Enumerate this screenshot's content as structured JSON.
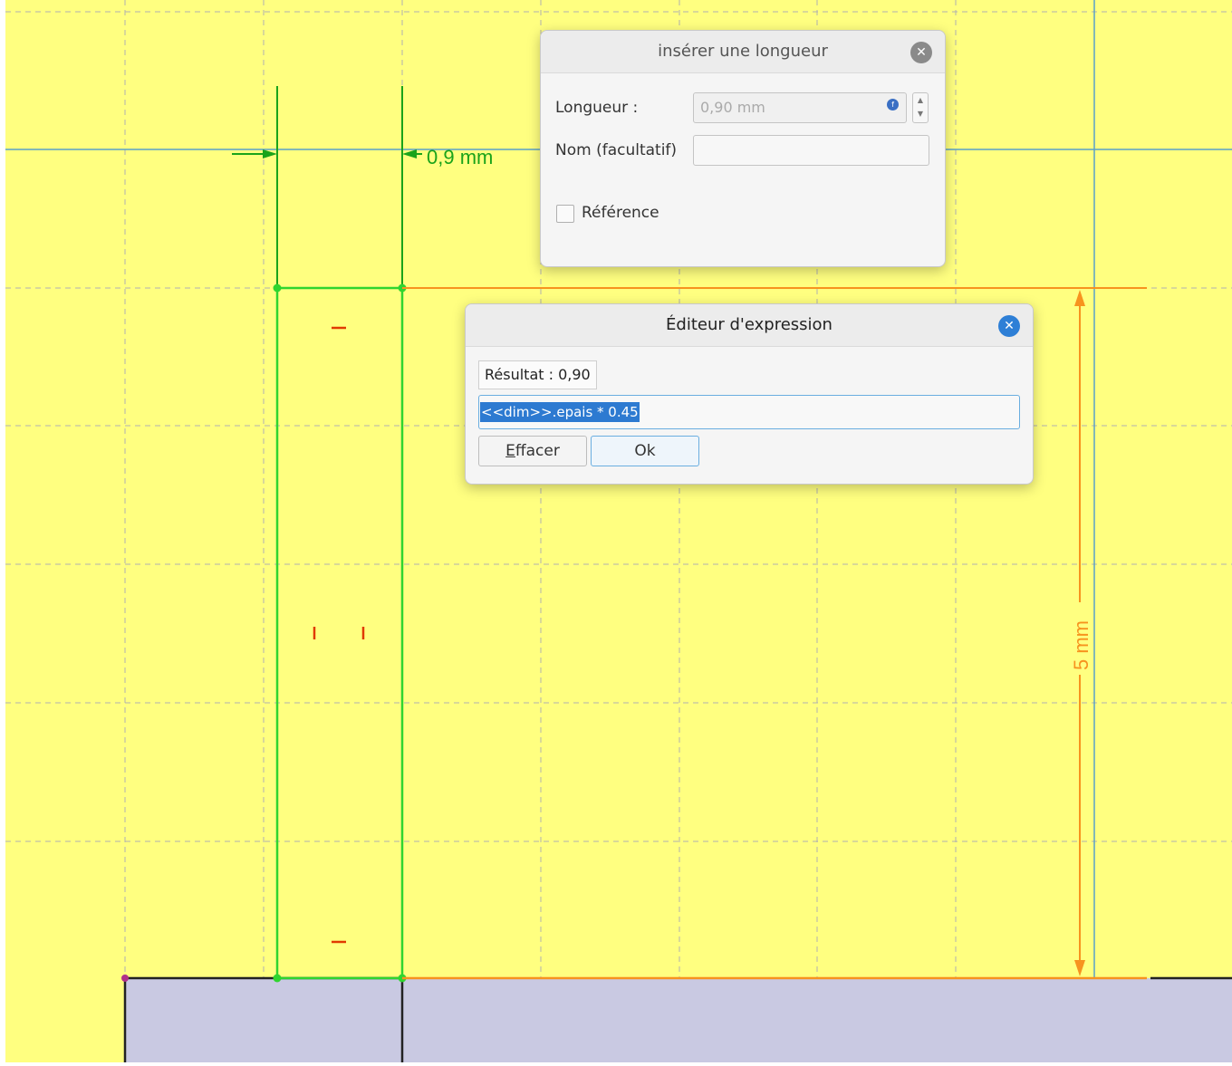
{
  "sketch": {
    "h_dimension_label": "0,9 mm",
    "v_dimension_label": "5 mm",
    "colors": {
      "background": "#ffff80",
      "grid": "#b0b0b0",
      "axis": "#5aa0c8",
      "constraint_green": "#2fd52f",
      "dimension_green": "#1aa31a",
      "dimension_orange": "#f7931e",
      "solid_body": "#c9c9e2",
      "marker_red": "#e03a00"
    }
  },
  "length_dialog": {
    "title": "insérer une longueur",
    "close_icon": "close-icon",
    "length_label": "Longueur :",
    "length_value": "0,90 mm",
    "name_label": "Nom (facultatif)",
    "name_value": "",
    "reference_label": "Référence",
    "reference_checked": false
  },
  "expression_dialog": {
    "title": "Éditeur d'expression",
    "close_icon": "close-icon",
    "result_text": "Résultat : 0,90",
    "expression": "<<dim>>.epais * 0.45",
    "clear_button_first": "E",
    "clear_button_rest": "ffacer",
    "ok_button": "Ok"
  }
}
